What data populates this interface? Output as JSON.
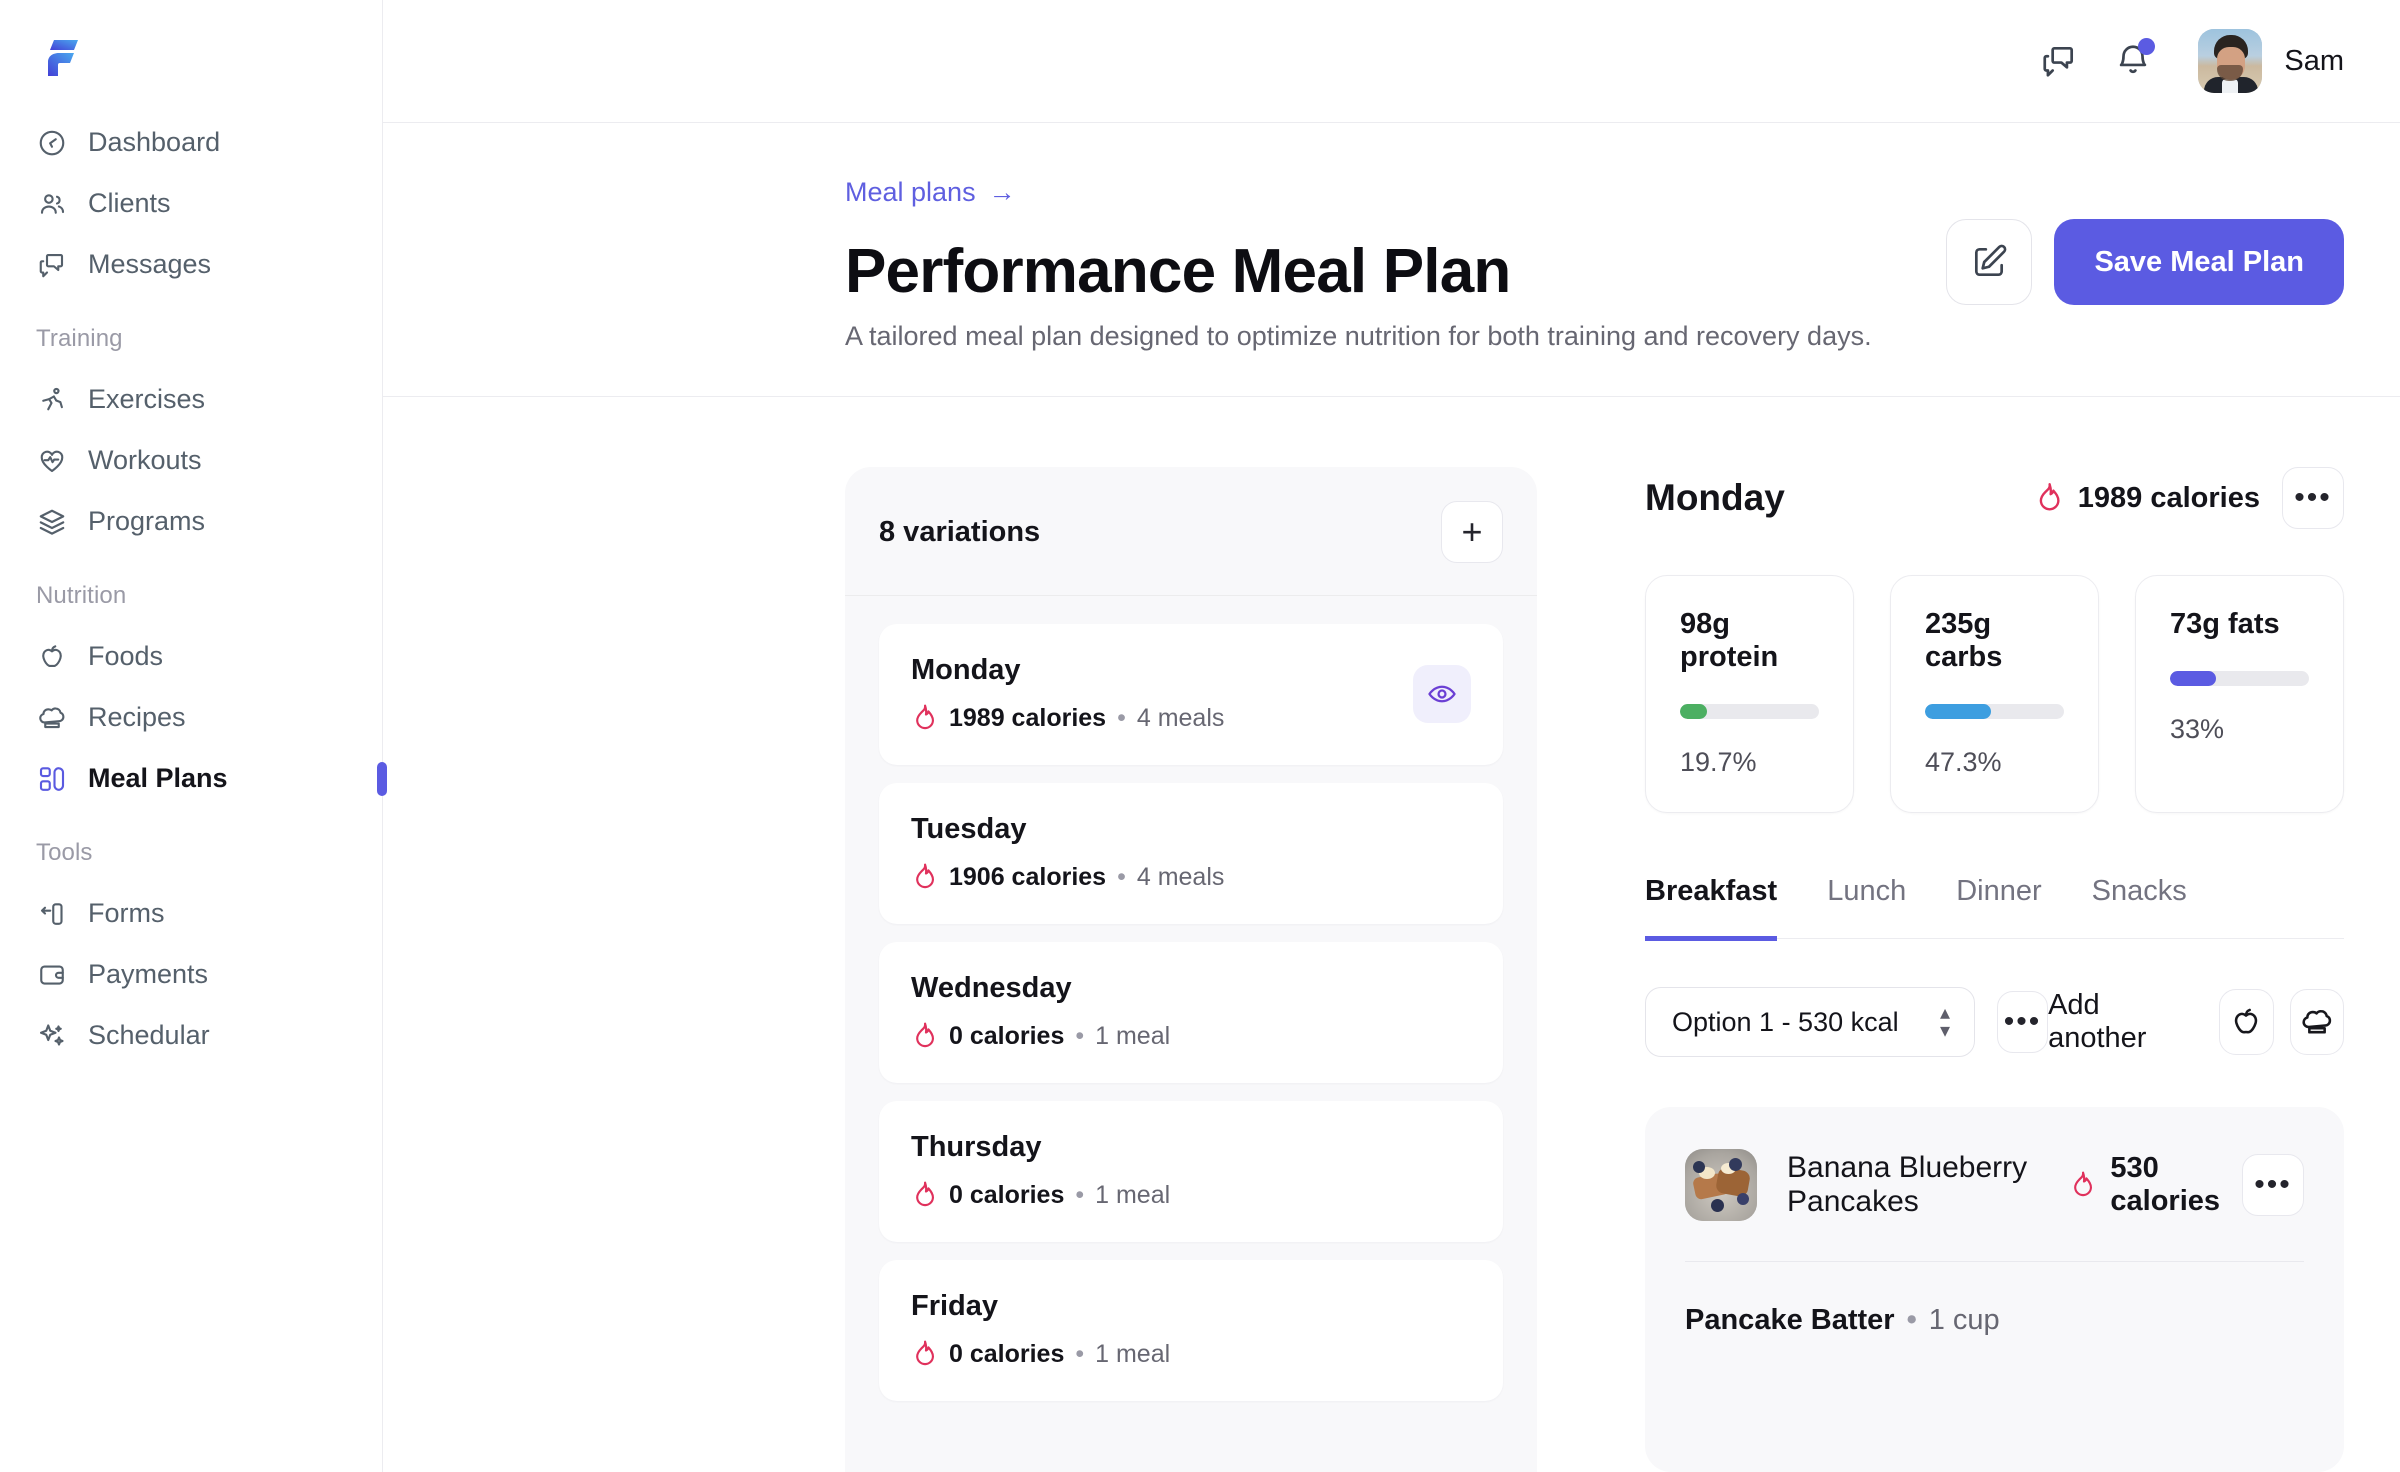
{
  "brand": {
    "logo_name": "fitness-logo",
    "accent": "#5b5be2"
  },
  "sidebar": {
    "groups": [
      {
        "label": "",
        "items": [
          {
            "label": "Dashboard",
            "icon": "dashboard-icon",
            "active": false
          },
          {
            "label": "Clients",
            "icon": "clients-icon",
            "active": false
          },
          {
            "label": "Messages",
            "icon": "messages-icon",
            "active": false
          }
        ]
      },
      {
        "label": "Training",
        "items": [
          {
            "label": "Exercises",
            "icon": "running-icon",
            "active": false
          },
          {
            "label": "Workouts",
            "icon": "heart-pulse-icon",
            "active": false
          },
          {
            "label": "Programs",
            "icon": "layers-icon",
            "active": false
          }
        ]
      },
      {
        "label": "Nutrition",
        "items": [
          {
            "label": "Foods",
            "icon": "apple-icon",
            "active": false
          },
          {
            "label": "Recipes",
            "icon": "chef-hat-icon",
            "active": false
          },
          {
            "label": "Meal Plans",
            "icon": "meal-plan-icon",
            "active": true
          }
        ]
      },
      {
        "label": "Tools",
        "items": [
          {
            "label": "Forms",
            "icon": "form-icon",
            "active": false
          },
          {
            "label": "Payments",
            "icon": "wallet-icon",
            "active": false
          },
          {
            "label": "Schedular",
            "icon": "sparkle-icon",
            "active": false
          }
        ]
      }
    ]
  },
  "topbar": {
    "chat_icon": "chat-icon",
    "bell_icon": "bell-icon",
    "has_notification": true,
    "username": "Sam"
  },
  "page": {
    "breadcrumb": "Meal plans",
    "breadcrumb_arrow": "→",
    "title": "Performance Meal Plan",
    "subtitle": "A tailored meal plan designed to optimize nutrition for both training and recovery days.",
    "edit_icon": "edit-pencil-icon",
    "save_label": "Save Meal Plan"
  },
  "variations": {
    "count_label": "8 variations",
    "add_label": "+",
    "items": [
      {
        "day": "Monday",
        "calories": "1989 calories",
        "meals": "4 meals",
        "selected": true,
        "eye_icon": "eye-icon"
      },
      {
        "day": "Tuesday",
        "calories": "1906 calories",
        "meals": "4 meals",
        "selected": false,
        "eye_icon": "eye-icon"
      },
      {
        "day": "Wednesday",
        "calories": "0 calories",
        "meals": "1 meal",
        "selected": false,
        "eye_icon": "eye-icon"
      },
      {
        "day": "Thursday",
        "calories": "0 calories",
        "meals": "1 meal",
        "selected": false,
        "eye_icon": "eye-icon"
      },
      {
        "day": "Friday",
        "calories": "0 calories",
        "meals": "1 meal",
        "selected": false,
        "eye_icon": "eye-icon"
      }
    ]
  },
  "detail": {
    "day": "Monday",
    "calories": "1989 calories",
    "more_label": "•••",
    "macros": [
      {
        "title": "98g protein",
        "percent_label": "19.7%",
        "percent": 19.7,
        "color": "#4caf62"
      },
      {
        "title": "235g carbs",
        "percent_label": "47.3%",
        "percent": 47.3,
        "color": "#3d9ee0"
      },
      {
        "title": "73g fats",
        "percent_label": "33%",
        "percent": 33.0,
        "color": "#5b5be2"
      }
    ],
    "tabs": [
      {
        "label": "Breakfast",
        "active": true
      },
      {
        "label": "Lunch",
        "active": false
      },
      {
        "label": "Dinner",
        "active": false
      },
      {
        "label": "Snacks",
        "active": false
      }
    ],
    "option_select": "Option 1 - 530 kcal",
    "option_more_label": "•••",
    "add_another_label": "Add another",
    "add_food_icon": "apple-icon",
    "add_recipe_icon": "chef-hat-icon",
    "meal": {
      "thumb": "pancakes-thumbnail",
      "name": "Banana Blueberry Pancakes",
      "calories": "530 calories",
      "more_label": "•••",
      "ingredient": "Pancake Batter",
      "ingredient_dot": "•",
      "ingredient_qty": "1 cup"
    }
  }
}
